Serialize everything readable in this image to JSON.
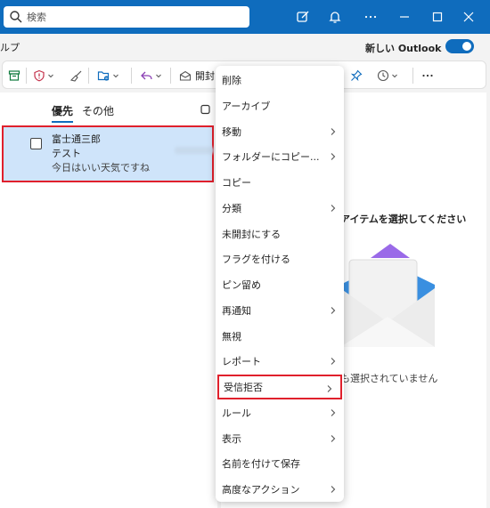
{
  "search": {
    "placeholder": "検索"
  },
  "ribbon": {
    "tab_partial": "ルプ",
    "new_outlook_label": "新しい Outlook"
  },
  "toolbar": {
    "open_label": "開封"
  },
  "list": {
    "tabs": [
      {
        "label": "優先"
      },
      {
        "label": "その他"
      }
    ],
    "item": {
      "sender": "富士通三郎",
      "subject": "テスト",
      "preview": "今日はいい天気ですね"
    }
  },
  "reading": {
    "title": "アイテムを選択してください",
    "empty": "も選択されていません"
  },
  "context_menu": {
    "items": [
      {
        "label": "削除",
        "submenu": false
      },
      {
        "label": "アーカイブ",
        "submenu": false
      },
      {
        "label": "移動",
        "submenu": true
      },
      {
        "label": "フォルダーにコピー...",
        "submenu": true
      },
      {
        "label": "コピー",
        "submenu": false
      },
      {
        "label": "分類",
        "submenu": true
      },
      {
        "label": "未開封にする",
        "submenu": false
      },
      {
        "label": "フラグを付ける",
        "submenu": false
      },
      {
        "label": "ピン留め",
        "submenu": false
      },
      {
        "label": "再通知",
        "submenu": true
      },
      {
        "label": "無視",
        "submenu": false
      },
      {
        "label": "レポート",
        "submenu": true
      },
      {
        "label": "受信拒否",
        "submenu": true,
        "highlighted": true
      },
      {
        "label": "ルール",
        "submenu": true
      },
      {
        "label": "表示",
        "submenu": true
      },
      {
        "label": "名前を付けて保存",
        "submenu": false
      },
      {
        "label": "高度なアクション",
        "submenu": true
      }
    ]
  },
  "colors": {
    "accent": "#0f6cbd",
    "highlight_border": "#e0202c",
    "selected_bg": "#cfe4fa"
  }
}
